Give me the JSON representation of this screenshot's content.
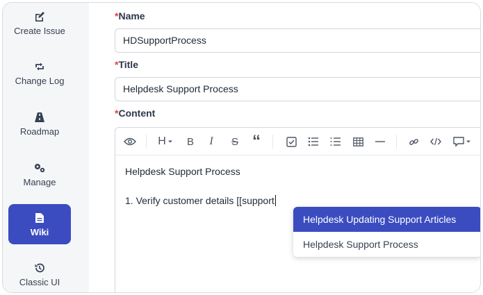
{
  "sidebar": {
    "items": [
      {
        "label": "Create Issue",
        "icon": "edit-icon",
        "active": false
      },
      {
        "label": "Change Log",
        "icon": "repeat-icon",
        "active": false
      },
      {
        "label": "Roadmap",
        "icon": "road-icon",
        "active": false
      },
      {
        "label": "Manage",
        "icon": "gears-icon",
        "active": false
      },
      {
        "label": "Wiki",
        "icon": "document-icon",
        "active": true
      },
      {
        "label": "Classic UI",
        "icon": "history-icon",
        "active": false
      }
    ]
  },
  "form": {
    "required_mark": "*",
    "name_label": "Name",
    "name_value": "HDSupportProcess",
    "title_label": "Title",
    "title_value": "Helpdesk Support Process",
    "content_label": "Content"
  },
  "editor": {
    "toolbar": [
      "preview-icon",
      "heading-icon",
      "bold-icon",
      "italic-icon",
      "strikethrough-icon",
      "quote-icon",
      "task-list-icon",
      "bullet-list-icon",
      "ordered-list-icon",
      "table-icon",
      "horizontal-rule-icon",
      "link-icon",
      "code-icon",
      "comment-icon"
    ],
    "heading_glyph": "H",
    "bold_glyph": "B",
    "italic_glyph": "I",
    "strike_glyph": "S",
    "quote_glyph": "“",
    "line1": "Helpdesk Support Process",
    "line2": "1. Verify customer details [[support"
  },
  "autocomplete": {
    "items": [
      {
        "label": "Helpdesk Updating Support Articles",
        "selected": true
      },
      {
        "label": "Helpdesk Support Process",
        "selected": false
      }
    ]
  },
  "colors": {
    "accent": "#3b4cc0",
    "required": "#e53e3e",
    "sidebar_bg": "#f5f6f8"
  }
}
